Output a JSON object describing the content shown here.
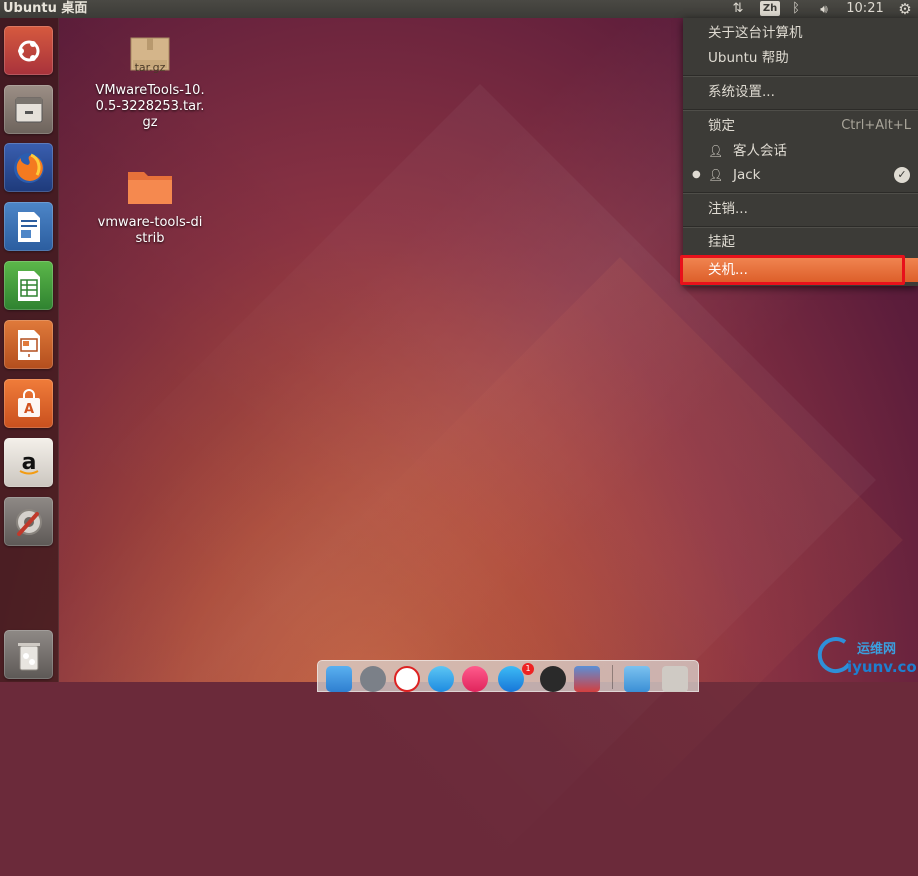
{
  "top_panel": {
    "title": "Ubuntu 桌面",
    "ime_label": "Zh",
    "clock": "10:21",
    "indicators": [
      "network-arrows-icon",
      "bluetooth-icon",
      "volume-icon",
      "gear-icon"
    ]
  },
  "launcher": {
    "items": [
      {
        "name": "dash-home",
        "icon": "ubuntu-logo-icon"
      },
      {
        "name": "files",
        "icon": "file-cabinet-icon"
      },
      {
        "name": "firefox",
        "icon": "firefox-icon"
      },
      {
        "name": "libreoffice-writer",
        "icon": "writer-document-icon"
      },
      {
        "name": "libreoffice-calc",
        "icon": "calc-spreadsheet-icon"
      },
      {
        "name": "libreoffice-impress",
        "icon": "impress-presentation-icon"
      },
      {
        "name": "ubuntu-software-center",
        "icon": "shopping-bag-icon"
      },
      {
        "name": "amazon",
        "icon": "amazon-logo-icon"
      },
      {
        "name": "system-settings",
        "icon": "settings-wrench-gear-icon"
      },
      {
        "name": "trash",
        "icon": "trash-icon"
      }
    ]
  },
  "desktop": {
    "icons": [
      {
        "label": "VMwareTools-10.0.5-3228253.tar.gz",
        "badge": "tar.gz",
        "icon": "archive-box-icon"
      },
      {
        "label": "vmware-tools-distrib",
        "icon": "folder-icon"
      }
    ]
  },
  "session_menu": {
    "about": "关于这台计算机",
    "help": "Ubuntu 帮助",
    "settings": "系统设置...",
    "lock": "锁定",
    "lock_accel": "Ctrl+Alt+L",
    "guest": "客人会话",
    "user": "Jack",
    "logout": "注销...",
    "suspend": "挂起",
    "shutdown": "关机..."
  },
  "dock": {
    "badge_count": "1"
  },
  "watermark": {
    "text_cn": "运维网",
    "url": "iyunv.com"
  },
  "colors": {
    "panel_bg": "#3c3b37",
    "highlight": "#e8682f",
    "annotation_red": "#e8111b"
  }
}
